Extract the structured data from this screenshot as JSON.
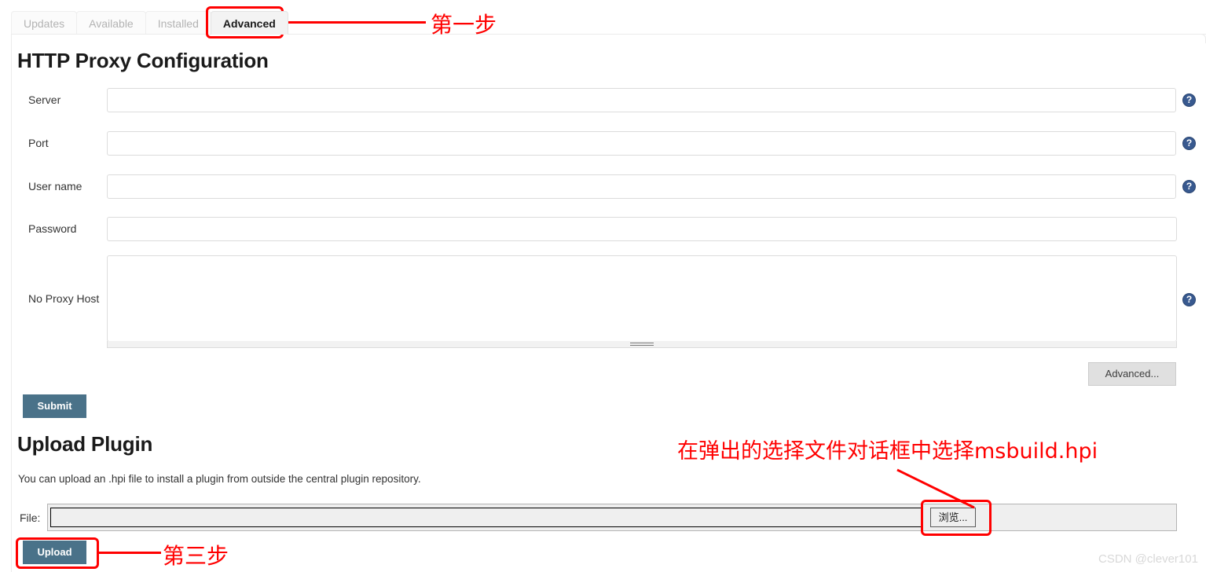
{
  "tabs": [
    {
      "label": "Updates",
      "active": false
    },
    {
      "label": "Available",
      "active": false
    },
    {
      "label": "Installed",
      "active": false
    },
    {
      "label": "Advanced",
      "active": true
    }
  ],
  "proxy_section": {
    "heading": "HTTP Proxy Configuration",
    "fields": [
      {
        "label": "Server",
        "value": "",
        "placeholder": "",
        "help": "?"
      },
      {
        "label": "Port",
        "value": "",
        "placeholder": "",
        "help": "?"
      },
      {
        "label": "User name",
        "value": "",
        "placeholder": "",
        "help": "?"
      },
      {
        "label": "Password",
        "value": "",
        "placeholder": "",
        "help": ""
      },
      {
        "label": "No Proxy Host",
        "value": "",
        "placeholder": "",
        "help": "?"
      }
    ],
    "advanced_button": "Advanced...",
    "submit_button": "Submit"
  },
  "upload_section": {
    "heading": "Upload Plugin",
    "description": "You can upload an .hpi file to install a plugin from outside the central plugin repository.",
    "file_label": "File:",
    "file_value": "",
    "browse_button": "浏览...",
    "upload_button": "Upload"
  },
  "annotations": {
    "step_one": "第一步",
    "step_three": "第三步",
    "dialog_note": "在弹出的选择文件对话框中选择msbuild.hpi"
  },
  "watermark": "CSDN @clever101",
  "colors": {
    "accent_blue": "#4a7289",
    "help_blue": "#38598f",
    "annotation_red": "#ff0000",
    "tab_active_bg": "#f3f3f3",
    "border_gray": "#dcdcdc"
  }
}
